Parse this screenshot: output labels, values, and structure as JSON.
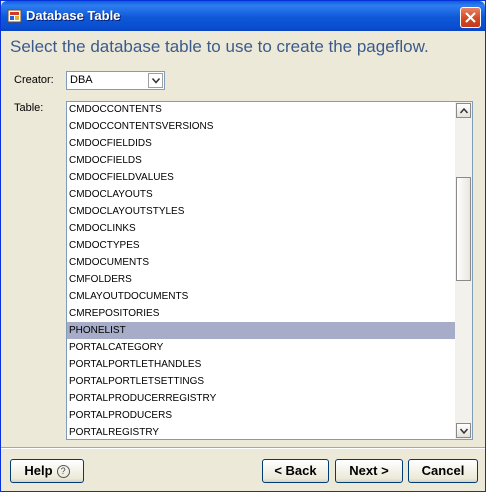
{
  "window": {
    "title": "Database Table"
  },
  "heading": "Select the database table to use to create the pageflow.",
  "creator": {
    "label": "Creator:",
    "value": "DBA"
  },
  "table": {
    "label": "Table:",
    "items": [
      "CMDOCCONTENTS",
      "CMDOCCONTENTSVERSIONS",
      "CMDOCFIELDIDS",
      "CMDOCFIELDS",
      "CMDOCFIELDVALUES",
      "CMDOCLAYOUTS",
      "CMDOCLAYOUTSTYLES",
      "CMDOCLINKS",
      "CMDOCTYPES",
      "CMDOCUMENTS",
      "CMFOLDERS",
      "CMLAYOUTDOCUMENTS",
      "CMREPOSITORIES",
      "PHONELIST",
      "PORTALCATEGORY",
      "PORTALPORTLETHANDLES",
      "PORTALPORTLETSETTINGS",
      "PORTALPRODUCERREGISTRY",
      "PORTALPRODUCERS",
      "PORTALREGISTRY"
    ],
    "selected": "PHONELIST"
  },
  "buttons": {
    "help": "Help",
    "help_glyph": "?",
    "back": "< Back",
    "next": "Next >",
    "cancel": "Cancel"
  },
  "colors": {
    "accent": "#3c5b8a",
    "selection": "#a7adc8",
    "titlebar": "#0a4fd0"
  }
}
